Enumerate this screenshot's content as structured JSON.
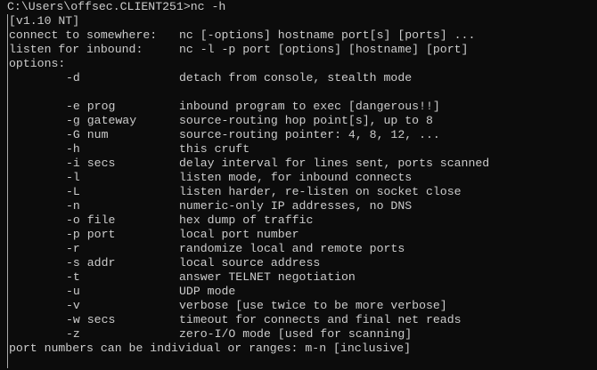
{
  "prompt": "C:\\Users\\offsec.CLIENT251>nc -h",
  "version": "[v1.10 NT]",
  "usage": [
    {
      "label": "connect to somewhere:",
      "text": "nc [-options] hostname port[s] [ports] ..."
    },
    {
      "label": "listen for inbound:",
      "text": "nc -l -p port [options] [hostname] [port]"
    }
  ],
  "options_header": "options:",
  "detach_option": {
    "flag": "-d",
    "desc": "detach from console, stealth mode"
  },
  "options": [
    {
      "flag": "-e prog",
      "desc": "inbound program to exec [dangerous!!]"
    },
    {
      "flag": "-g gateway",
      "desc": "source-routing hop point[s], up to 8"
    },
    {
      "flag": "-G num",
      "desc": "source-routing pointer: 4, 8, 12, ..."
    },
    {
      "flag": "-h",
      "desc": "this cruft"
    },
    {
      "flag": "-i secs",
      "desc": "delay interval for lines sent, ports scanned"
    },
    {
      "flag": "-l",
      "desc": "listen mode, for inbound connects"
    },
    {
      "flag": "-L",
      "desc": "listen harder, re-listen on socket close"
    },
    {
      "flag": "-n",
      "desc": "numeric-only IP addresses, no DNS"
    },
    {
      "flag": "-o file",
      "desc": "hex dump of traffic"
    },
    {
      "flag": "-p port",
      "desc": "local port number"
    },
    {
      "flag": "-r",
      "desc": "randomize local and remote ports"
    },
    {
      "flag": "-s addr",
      "desc": "local source address"
    },
    {
      "flag": "-t",
      "desc": "answer TELNET negotiation"
    },
    {
      "flag": "-u",
      "desc": "UDP mode"
    },
    {
      "flag": "-v",
      "desc": "verbose [use twice to be more verbose]"
    },
    {
      "flag": "-w secs",
      "desc": "timeout for connects and final net reads"
    },
    {
      "flag": "-z",
      "desc": "zero-I/O mode [used for scanning]"
    }
  ],
  "footer": "port numbers can be individual or ranges: m-n [inclusive]"
}
